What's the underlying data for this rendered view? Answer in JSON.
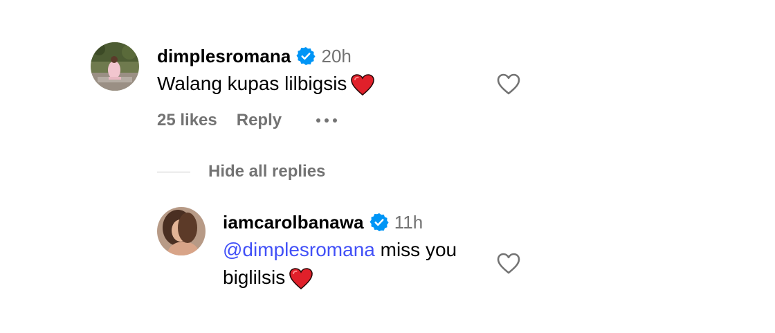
{
  "comments": [
    {
      "username": "dimplesromana",
      "verified": true,
      "timestamp": "20h",
      "text": "Walang kupas lilbigsis",
      "emoji": "red-heart",
      "likes": "25 likes",
      "reply_label": "Reply",
      "more_icon": "more-horizontal-icon",
      "like_icon": "heart-outline-icon"
    }
  ],
  "thread": {
    "hide_replies_label": "Hide all replies"
  },
  "replies": [
    {
      "username": "iamcarolbanawa",
      "verified": true,
      "timestamp": "11h",
      "mention": "@dimplesromana",
      "text_line1": " miss you",
      "text_line2": "biglilsis",
      "emoji": "red-heart",
      "like_icon": "heart-outline-icon"
    }
  ],
  "colors": {
    "text": "#000000",
    "secondary": "#737373",
    "mention": "#4150f7",
    "verified_badge": "#0095f6",
    "heart": "#e0202a"
  }
}
